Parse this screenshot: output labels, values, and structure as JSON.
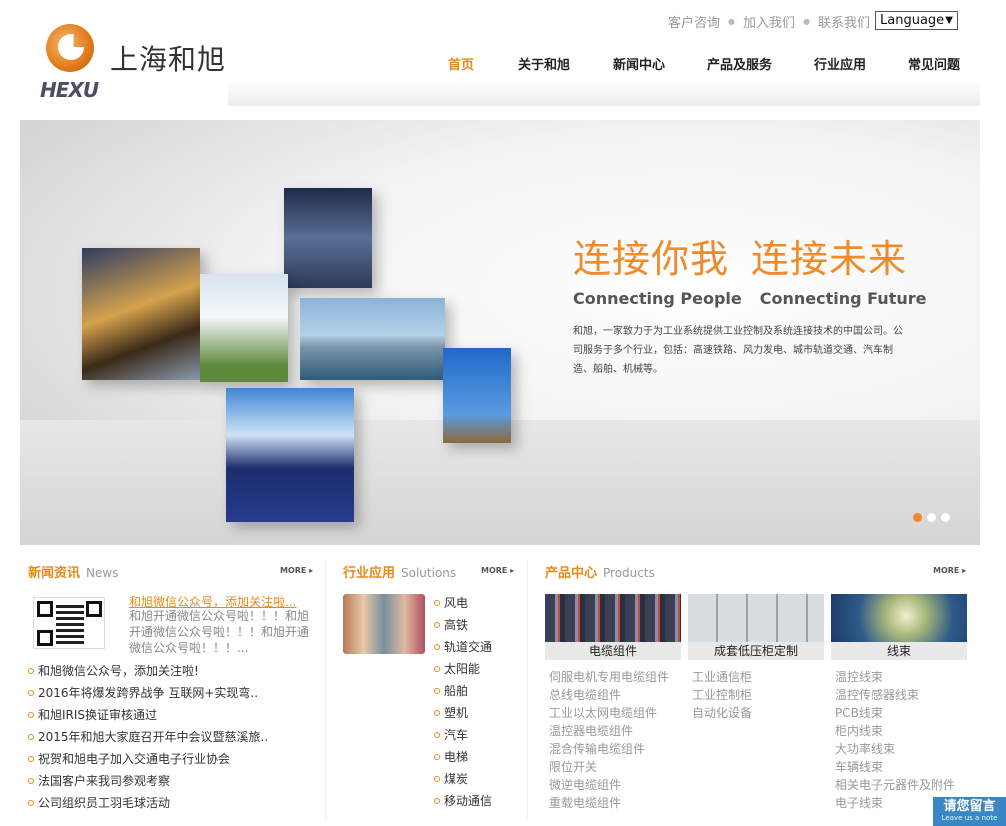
{
  "top_links": [
    "客户咨询",
    "加入我们",
    "联系我们"
  ],
  "language": "Language",
  "logo": {
    "cn": "上海和旭",
    "en": "HEXU"
  },
  "nav": [
    "首页",
    "关于和旭",
    "新闻中心",
    "产品及服务",
    "行业应用",
    "常见问题"
  ],
  "banner": {
    "slogan_cn_1": "连接你我",
    "slogan_cn_2": "连接未来",
    "slogan_en_1": "Connecting People",
    "slogan_en_2": "Connecting Future",
    "description": "和旭，一家致力于为工业系统提供工业控制及系统连接技术的中国公司。公司服务于多个行业，包括：高速铁路、风力发电、城市轨道交通、汽车制造、船舶、机械等。"
  },
  "colors": {
    "accent": "#e88a1a",
    "note_bg": "#3a87c4"
  },
  "news": {
    "title": "新闻资讯",
    "title_en": "News",
    "more": "MORE ▸",
    "featured_title": "和旭微信公众号，添加关注啦...",
    "featured_text": "和旭开通微信公众号啦！！！和旭开通微信公众号啦！！！和旭开通微信公众号啦！！！...",
    "items": [
      "和旭微信公众号，添加关注啦!",
      "2016年将爆发跨界战争 互联网+实现弯..",
      "和旭IRIS换证审核通过",
      "2015年和旭大家庭召开年中会议暨慈溪旅..",
      "祝贺和旭电子加入交通电子行业协会",
      "法国客户来我司参观考察",
      "公司组织员工羽毛球活动"
    ]
  },
  "solutions": {
    "title": "行业应用",
    "title_en": "Solutions",
    "more": "MORE ▸",
    "items": [
      "风电",
      "高铁",
      "轨道交通",
      "太阳能",
      "船舶",
      "塑机",
      "汽车",
      "电梯",
      "煤炭",
      "移动通信"
    ]
  },
  "products": {
    "title": "产品中心",
    "title_en": "Products",
    "more": "MORE ▸",
    "cards": [
      {
        "label": "电缆组件",
        "items": [
          "伺服电机专用电缆组件",
          "总线电缆组件",
          "工业以太网电缆组件",
          "温控器电缆组件",
          "混合传输电缆组件",
          "限位开关",
          "微逆电缆组件",
          "重载电缆组件"
        ]
      },
      {
        "label": "成套低压柜定制",
        "items": [
          "工业通信柜",
          "工业控制柜",
          "自动化设备"
        ]
      },
      {
        "label": "线束",
        "items": [
          "温控线束",
          "温控传感器线束",
          "PCB线束",
          "柜内线束",
          "大功率线束",
          "车辆线束",
          "相关电子元器件及附件",
          "电子线束"
        ]
      }
    ]
  },
  "leave_note": {
    "cn": "请您留言",
    "en": "Leave us a note"
  }
}
